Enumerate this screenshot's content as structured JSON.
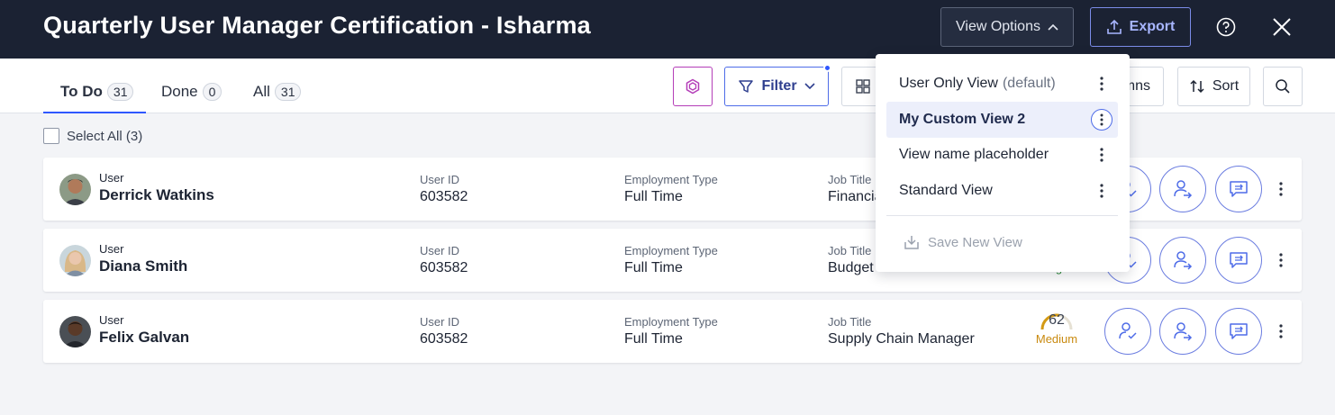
{
  "header": {
    "title": "Quarterly User Manager Certification - Isharma",
    "view_options_label": "View Options",
    "export_label": "Export"
  },
  "tabs": [
    {
      "label": "To Do",
      "count": "31"
    },
    {
      "label": "Done",
      "count": "0"
    },
    {
      "label": "All",
      "count": "31"
    }
  ],
  "toolbar": {
    "filter_label": "Filter",
    "columns_label": "Columns",
    "sort_label": "Sort"
  },
  "select_all_label": "Select All (3)",
  "rows": [
    {
      "user_label": "User",
      "name": "Derrick Watkins",
      "userid_label": "User ID",
      "userid": "603582",
      "emp_label": "Employment Type",
      "emp": "Full Time",
      "job_label": "Job Title",
      "job": "Financial Analyst",
      "risk_score": "",
      "risk_level": ""
    },
    {
      "user_label": "User",
      "name": "Diana Smith",
      "userid_label": "User ID",
      "userid": "603582",
      "emp_label": "Employment Type",
      "emp": "Full Time",
      "job_label": "Job Title",
      "job": "Budget Coordinator",
      "risk_score": "",
      "risk_level": "High"
    },
    {
      "user_label": "User",
      "name": "Felix Galvan",
      "userid_label": "User ID",
      "userid": "603582",
      "emp_label": "Employment Type",
      "emp": "Full Time",
      "job_label": "Job Title",
      "job": "Supply Chain Manager",
      "risk_score": "62",
      "risk_level": "Medium"
    }
  ],
  "dropdown": {
    "items": [
      {
        "label": "User Only View",
        "suffix": "(default)"
      },
      {
        "label": "My Custom View 2",
        "suffix": ""
      },
      {
        "label": "View name placeholder",
        "suffix": ""
      },
      {
        "label": "Standard View",
        "suffix": ""
      }
    ],
    "save_label": "Save New View"
  },
  "colors": {
    "header_bg": "#1b2233",
    "accent": "#2f57ff",
    "risk_high": "#2e8b3a",
    "risk_medium": "#c98a10"
  }
}
